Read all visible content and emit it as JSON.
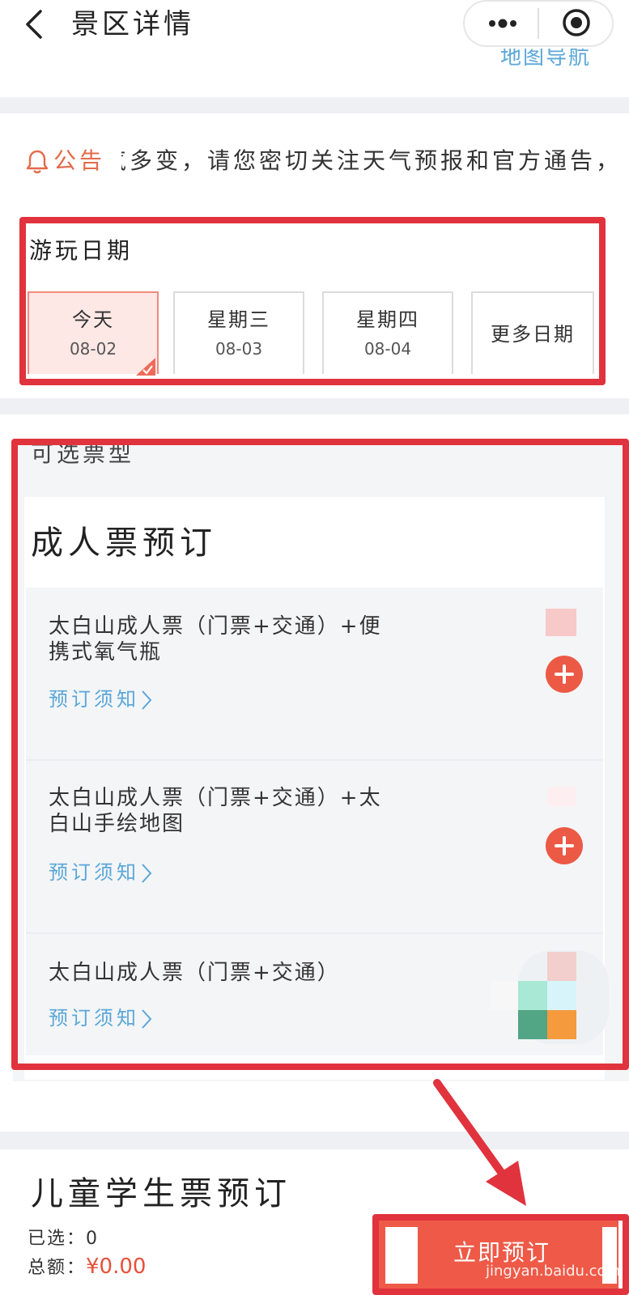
{
  "header": {
    "title": "景区详情",
    "map_link": "地图导航"
  },
  "notice": {
    "label": "公告",
    "text": "天气多变，请您密切关注天气预报和官方通告，合"
  },
  "date": {
    "title": "游玩日期",
    "options": [
      {
        "weekday": "今天",
        "date": "08-02",
        "selected": true
      },
      {
        "weekday": "星期三",
        "date": "08-03",
        "selected": false
      },
      {
        "weekday": "星期四",
        "date": "08-04",
        "selected": false
      }
    ],
    "more_label": "更多日期"
  },
  "tickets": {
    "section_label": "可选票型",
    "adult_title": "成人票预订",
    "items": [
      {
        "name": "太白山成人票（门票+交通）+便携式氧气瓶",
        "notice_label": "预订须知"
      },
      {
        "name": "太白山成人票（门票+交通）+太白山手绘地图",
        "notice_label": "预订须知"
      },
      {
        "name": "太白山成人票（门票+交通）",
        "notice_label": "预订须知"
      }
    ],
    "child_title": "儿童学生票预订"
  },
  "bottom_bar": {
    "selected_label": "已选：",
    "selected_count": "0",
    "total_label": "总额：",
    "total_amount": "¥0.00",
    "book_label": "立即预订"
  },
  "watermark": {
    "text": "jingyan.baidu.com"
  },
  "colors": {
    "accent": "#ec5a46",
    "link": "#5aa7d9",
    "highlight": "#e0333d",
    "selected_bg": "#fde8e6"
  }
}
